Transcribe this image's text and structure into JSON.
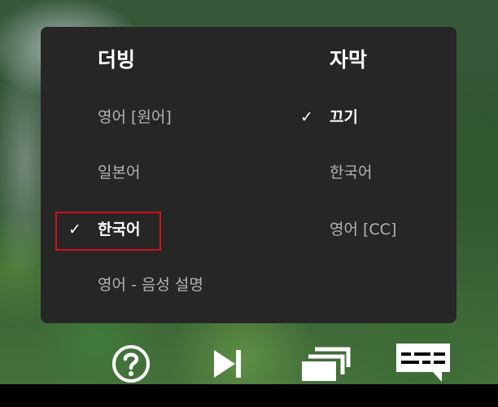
{
  "menu": {
    "audio": {
      "heading": "더빙",
      "options": [
        {
          "label": "영어 [원어]",
          "selected": false
        },
        {
          "label": "일본어",
          "selected": false
        },
        {
          "label": "한국어",
          "selected": true
        },
        {
          "label": "영어 - 음성 설명",
          "selected": false
        }
      ]
    },
    "subtitles": {
      "heading": "자막",
      "options": [
        {
          "label": "끄기",
          "selected": true
        },
        {
          "label": "한국어",
          "selected": false
        },
        {
          "label": "영어 [CC]",
          "selected": false
        }
      ]
    },
    "check_mark": "✓",
    "highlight_color": "#d0121b"
  },
  "controls": {
    "icons": [
      "help-icon",
      "next-episode-icon",
      "episodes-icon",
      "audio-subtitles-icon"
    ]
  }
}
